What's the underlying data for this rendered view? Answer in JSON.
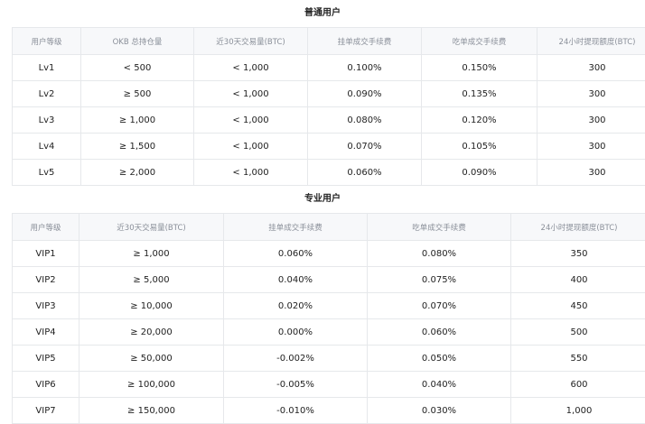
{
  "regular": {
    "title": "普通用户",
    "headers": [
      "用户等级",
      "OKB 总持仓量",
      "近30天交易量(BTC)",
      "挂单成交手续费",
      "吃单成交手续费",
      "24小时提现额度(BTC)"
    ],
    "rows": [
      [
        "Lv1",
        "< 500",
        "< 1,000",
        "0.100%",
        "0.150%",
        "300"
      ],
      [
        "Lv2",
        "≥ 500",
        "< 1,000",
        "0.090%",
        "0.135%",
        "300"
      ],
      [
        "Lv3",
        "≥ 1,000",
        "< 1,000",
        "0.080%",
        "0.120%",
        "300"
      ],
      [
        "Lv4",
        "≥ 1,500",
        "< 1,000",
        "0.070%",
        "0.105%",
        "300"
      ],
      [
        "Lv5",
        "≥ 2,000",
        "< 1,000",
        "0.060%",
        "0.090%",
        "300"
      ]
    ]
  },
  "professional": {
    "title": "专业用户",
    "headers": [
      "用户等级",
      "近30天交易量(BTC)",
      "挂单成交手续费",
      "吃单成交手续费",
      "24小时提现额度(BTC)"
    ],
    "rows": [
      [
        "VIP1",
        "≥ 1,000",
        "0.060%",
        "0.080%",
        "350"
      ],
      [
        "VIP2",
        "≥ 5,000",
        "0.040%",
        "0.075%",
        "400"
      ],
      [
        "VIP3",
        "≥ 10,000",
        "0.020%",
        "0.070%",
        "450"
      ],
      [
        "VIP4",
        "≥ 20,000",
        "0.000%",
        "0.060%",
        "500"
      ],
      [
        "VIP5",
        "≥ 50,000",
        "-0.002%",
        "0.050%",
        "550"
      ],
      [
        "VIP6",
        "≥ 100,000",
        "-0.005%",
        "0.040%",
        "600"
      ],
      [
        "VIP7",
        "≥ 150,000",
        "-0.010%",
        "0.030%",
        "1,000"
      ]
    ]
  }
}
